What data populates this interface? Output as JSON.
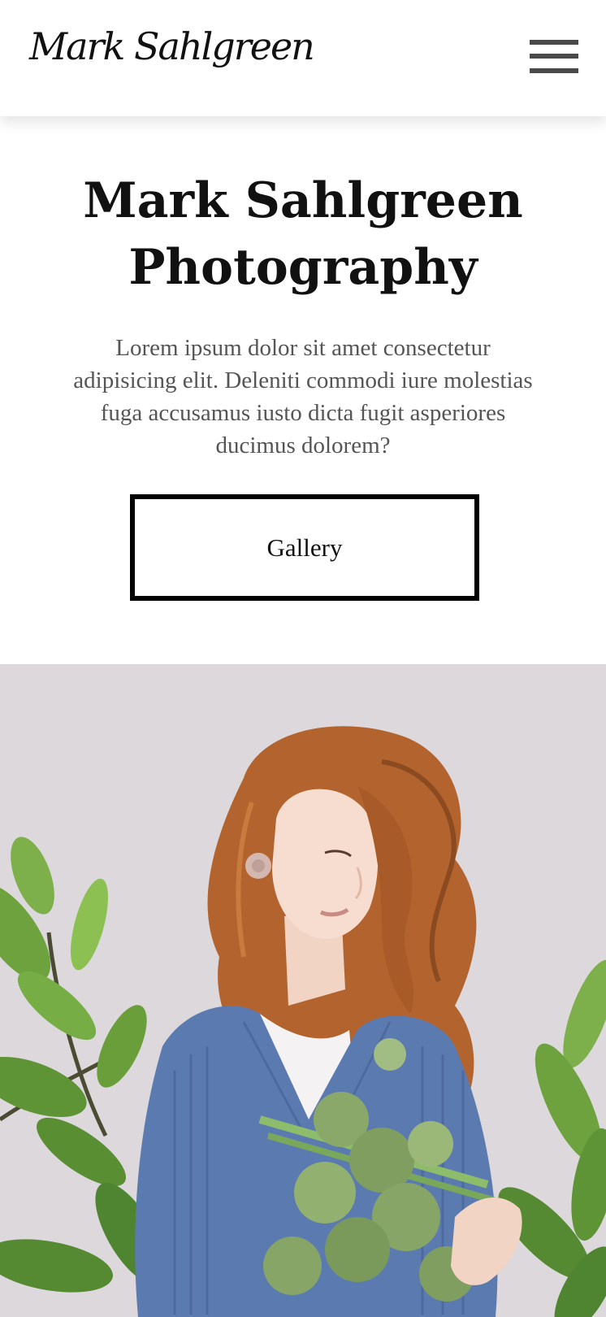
{
  "header": {
    "logo_text": "Mark Sahlgreen",
    "menu_icon": "hamburger-menu-icon"
  },
  "hero": {
    "title_line1": "Mark Sahlgreen",
    "title_line2": "Photography",
    "description": "Lorem ipsum dolor sit amet consectetur adipisicing elit. Deleniti commodi iure molestias fuga accusamus iusto dicta fugit asperiores ducimus dolorem?",
    "gallery_button": "Gallery"
  },
  "colors": {
    "background": "#ffffff",
    "text": "#111111",
    "muted_text": "#555555",
    "menu_icon": "#4a4a4a",
    "photo_background": "#dcd8dc"
  }
}
